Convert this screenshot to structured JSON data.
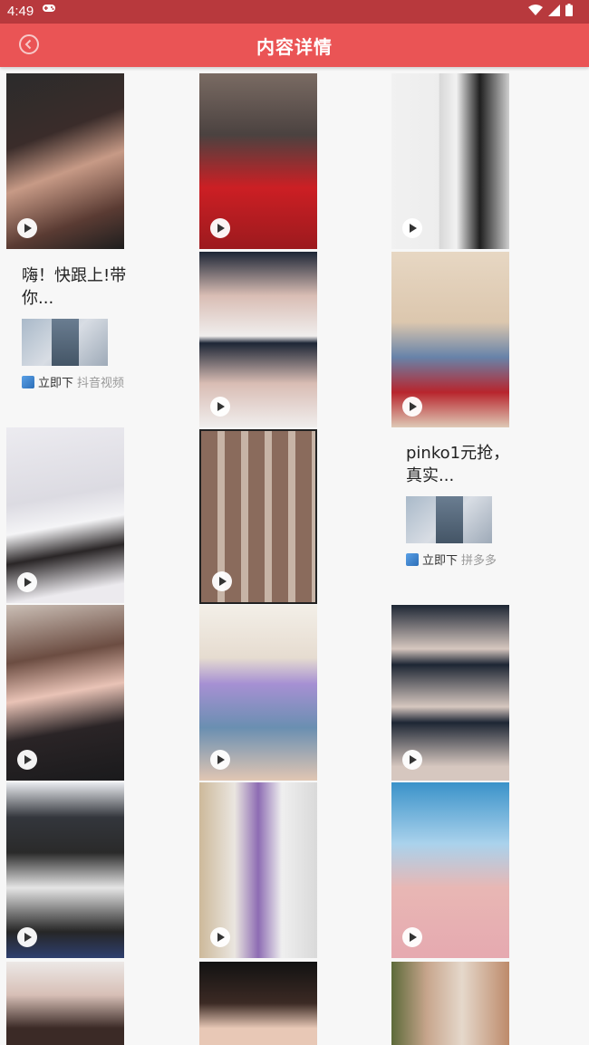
{
  "status": {
    "time": "4:49",
    "icons": [
      "gamepad-icon",
      "wifi-icon",
      "signal-icon",
      "battery-icon"
    ]
  },
  "toolbar": {
    "title": "内容详情",
    "back_icon": "back-arrow-icon"
  },
  "colors": {
    "statusbar": "#b8393d",
    "toolbar": "#ea5455"
  },
  "ads": [
    {
      "text": "嗨！快跟上!带你...",
      "cta": "立即下",
      "source": "抖音视频"
    },
    {
      "text": "pinko1元抢，真实...",
      "cta": "立即下",
      "source": "拼多多"
    }
  ],
  "videos": [
    {
      "icon": "play-icon"
    },
    {
      "icon": "play-icon"
    },
    {
      "icon": "play-icon"
    },
    {
      "icon": "play-icon"
    },
    {
      "icon": "play-icon"
    },
    {
      "icon": "play-icon"
    },
    {
      "icon": "play-icon"
    },
    {
      "icon": "play-icon"
    },
    {
      "icon": "play-icon"
    },
    {
      "icon": "play-icon"
    },
    {
      "icon": "play-icon"
    },
    {
      "icon": "play-icon"
    },
    {
      "icon": "play-icon"
    },
    {
      "icon": "play-icon"
    },
    {
      "icon": "play-icon"
    },
    {
      "icon": "play-icon"
    },
    {
      "icon": "play-icon"
    }
  ]
}
